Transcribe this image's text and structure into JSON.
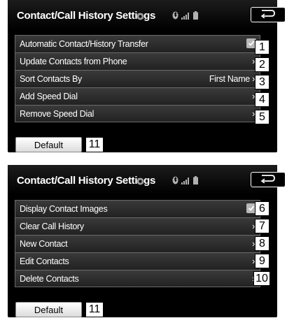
{
  "screens": [
    {
      "title": "Contact/Call History Settings",
      "items": [
        {
          "label": "Automatic Contact/History Transfer",
          "right": "",
          "checked": true,
          "callout": "1"
        },
        {
          "label": "Update Contacts from Phone",
          "right": "›",
          "callout": "2"
        },
        {
          "label": "Sort Contacts By",
          "right": "First Name ›",
          "callout": "3"
        },
        {
          "label": "Add Speed Dial",
          "right": "›",
          "callout": "4"
        },
        {
          "label": "Remove Speed Dial",
          "right": "›",
          "callout": "5"
        }
      ],
      "default_label": "Default",
      "default_callout": "11"
    },
    {
      "title": "Contact/Call History Settings",
      "items": [
        {
          "label": "Display Contact Images",
          "right": "",
          "checked": true,
          "callout": "6"
        },
        {
          "label": "Clear Call History",
          "right": "›",
          "callout": "7"
        },
        {
          "label": "New Contact",
          "right": "›",
          "callout": "8"
        },
        {
          "label": "Edit Contacts",
          "right": "›",
          "callout": "9"
        },
        {
          "label": "Delete Contacts",
          "right": "›",
          "callout": "10"
        }
      ],
      "default_label": "Default",
      "default_callout": "11"
    }
  ],
  "icons": {
    "status": [
      "settings-gear-icon",
      "bluetooth-icon",
      "signal-bars-icon",
      "battery-icon"
    ],
    "back": "back-arrow-icon",
    "checkbox": "checkmark-icon"
  },
  "colors": {
    "screen_bg": "#000000",
    "row_bg": "#2e2e2e",
    "row_border": "#6a6a6a",
    "text": "#ffffff",
    "checkbox": "#b8b8b8",
    "default_button": "#efefef"
  }
}
